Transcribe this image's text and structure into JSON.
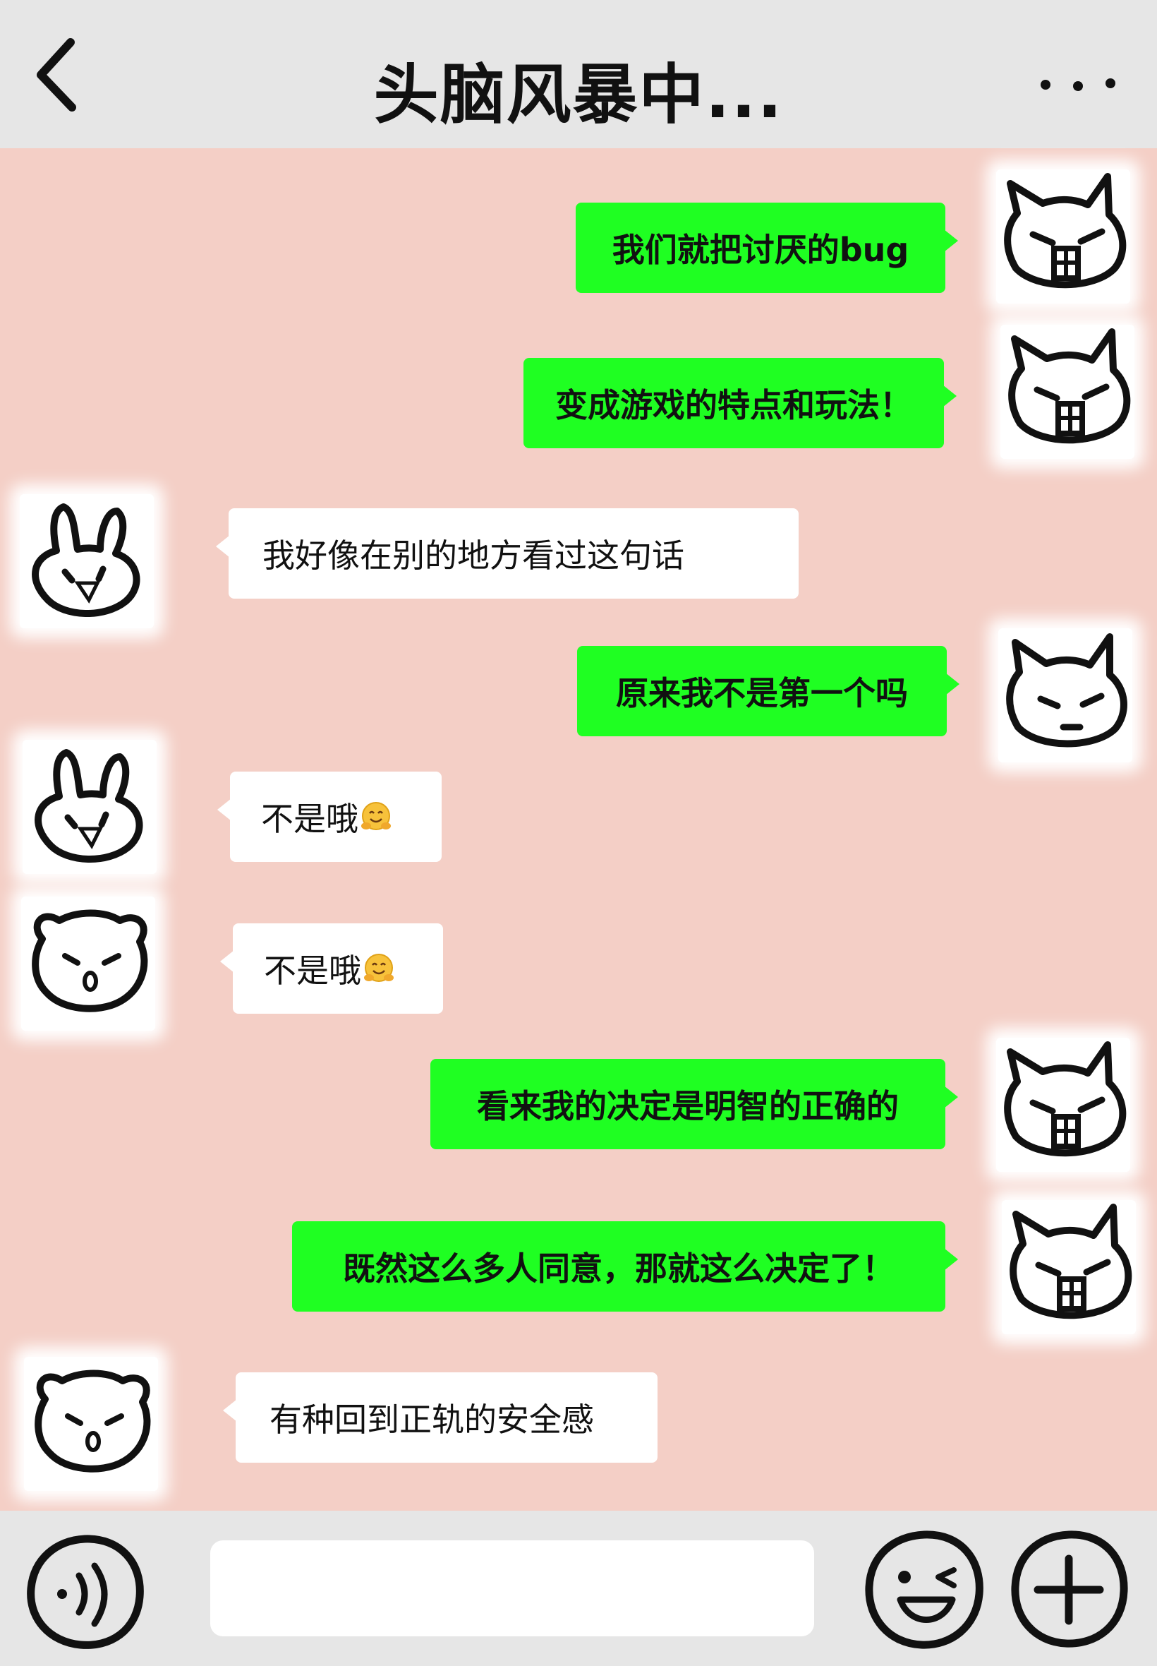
{
  "header": {
    "title": "头脑风暴中...",
    "back_icon": "chevron-left-icon",
    "more_icon": "more-dots-icon"
  },
  "messages": [
    {
      "side": "right",
      "text": "我们就把讨厌的bug",
      "avatar": "cat-angry"
    },
    {
      "side": "right",
      "text": "变成游戏的特点和玩法！",
      "avatar": "cat-angry"
    },
    {
      "side": "left",
      "text": "我好像在别的地方看过这句话",
      "avatar": "rabbit"
    },
    {
      "side": "right",
      "text": "原来我不是第一个吗",
      "avatar": "cat-calm"
    },
    {
      "side": "left",
      "text": "不是哦",
      "emoji": "hugging-face",
      "avatar": "rabbit"
    },
    {
      "side": "left",
      "text": "不是哦",
      "emoji": "hugging-face",
      "avatar": "bear"
    },
    {
      "side": "right",
      "text": "看来我的决定是明智的正确的",
      "avatar": "cat-angry"
    },
    {
      "side": "right",
      "text": "既然这么多人同意，那就这么决定了！",
      "avatar": "cat-angry"
    },
    {
      "side": "left",
      "text": "有种回到正轨的安全感",
      "avatar": "bear"
    }
  ],
  "footer": {
    "input_value": "",
    "voice_icon": "voice-icon",
    "emoji_icon": "wink-emoji-icon",
    "plus_icon": "plus-icon"
  },
  "colors": {
    "background": "#f4cfc6",
    "bar": "#e6e6e6",
    "my_bubble": "#1fff22",
    "other_bubble": "#ffffff"
  }
}
